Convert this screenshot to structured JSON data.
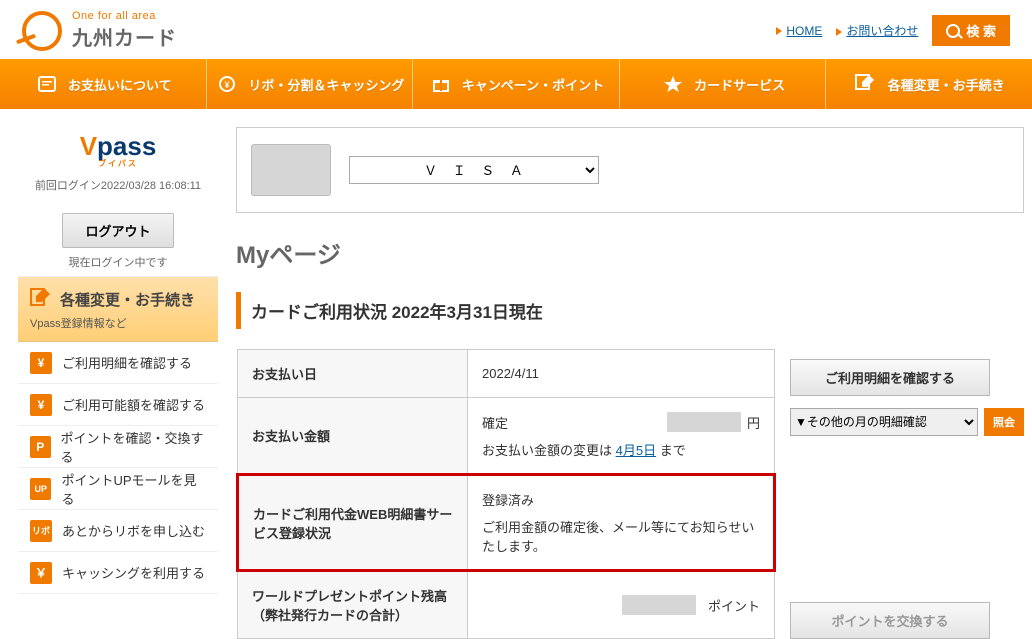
{
  "brand": {
    "tagline": "One for all area",
    "name": "九州カード"
  },
  "top_links": {
    "home": "HOME",
    "contact": "お問い合わせ",
    "search": "検 索"
  },
  "gnav": {
    "payment": "お支払いについて",
    "revo": "リボ・分割＆キャッシング",
    "campaign": "キャンペーン・ポイント",
    "service": "カードサービス",
    "henko": "各種変更・お手続き"
  },
  "vpass": {
    "ruby": "ブイパス"
  },
  "sidebar": {
    "last_login": "前回ログイン2022/03/28 16:08:11",
    "logout": "ログアウト",
    "login_status": "現在ログイン中です",
    "hero": {
      "title": "各種変更・お手続き",
      "sub": "Vpass登録情報など"
    },
    "items": [
      {
        "code": "¥",
        "label": "ご利用明細を確認する"
      },
      {
        "code": "¥",
        "label": "ご利用可能額を確認する"
      },
      {
        "code": "P",
        "label": "ポイントを確認・交換する"
      },
      {
        "code": "UP",
        "label": "ポイントUPモールを見る"
      },
      {
        "code": "リボ",
        "label": "あとからリボを申し込む"
      },
      {
        "code": "￥",
        "label": "キャッシングを利用する"
      }
    ]
  },
  "card_bar": {
    "selected_brand": "Ｖ Ｉ Ｓ Ａ"
  },
  "page_title": "Myページ",
  "section_heading": "カードご利用状況 2022年3月31日現在",
  "rows": {
    "pay_date": {
      "label": "お支払い日",
      "value": "2022/4/11"
    },
    "pay_amount": {
      "label": "お支払い金額",
      "confirmed": "確定",
      "yen": "円",
      "change_prefix": "お支払い金額の変更は ",
      "change_link": "4月5日",
      "change_suffix": " まで"
    },
    "web_meisai": {
      "label": "カードご利用代金WEB明細書サービス登録状況",
      "value": "登録済み",
      "note": "ご利用金額の確定後、メール等にてお知らせいたします。"
    },
    "points": {
      "label": "ワールドプレゼントポイント残高（弊社発行カードの合計）",
      "unit": "ポイント"
    }
  },
  "actions": {
    "check_meisai": "ご利用明細を確認する",
    "month_select": "▼その他の月の明細確認",
    "inquiry": "照会",
    "exchange_points": "ポイントを交換する"
  }
}
